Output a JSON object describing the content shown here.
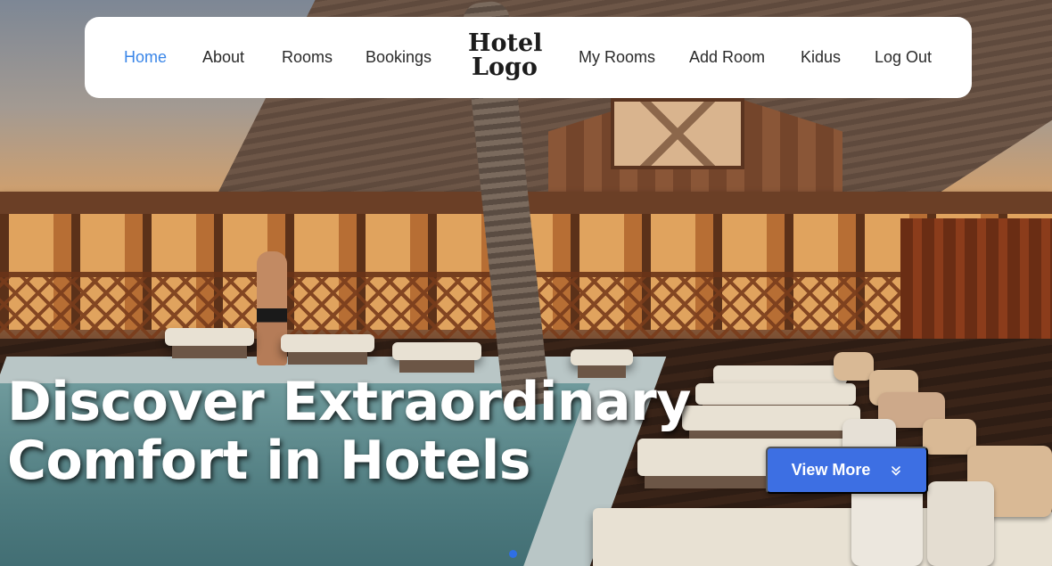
{
  "nav": {
    "links": [
      {
        "label": "Home",
        "active": true
      },
      {
        "label": "About"
      },
      {
        "label": "Rooms"
      },
      {
        "label": "Bookings"
      },
      {
        "label": "My Rooms"
      },
      {
        "label": "Add Room"
      },
      {
        "label": "Kidus"
      },
      {
        "label": "Log Out"
      }
    ],
    "logo": {
      "line1": "Hotel",
      "line2": "Logo"
    }
  },
  "hero": {
    "headline_line1": "Discover Extraordinary",
    "headline_line2": "Comfort in Hotels",
    "cta_label": "View More",
    "cta_icon": "chevrons-down-icon",
    "carousel": {
      "slides": 1,
      "active_index": 0
    }
  },
  "colors": {
    "accent": "#3d6fe3",
    "active_link": "#3a86e8",
    "nav_background": "#ffffff",
    "headline_text": "#ffffff"
  }
}
